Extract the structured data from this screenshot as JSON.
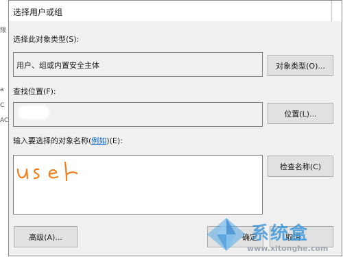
{
  "window_behind": {
    "fragments": [
      "限",
      "a",
      "C",
      "AC"
    ]
  },
  "dialog": {
    "title": "选择用户或组",
    "object_type": {
      "label": "选择此对象类型(S):",
      "value": "用户、组或内置安全主体",
      "button": "对象类型(O)..."
    },
    "location": {
      "label": "查找位置(F):",
      "value": "",
      "button": "位置(L)..."
    },
    "object_names": {
      "label_prefix": "输入要选择的对象名称(",
      "label_link": "例如",
      "label_suffix": ")(E):",
      "handwritten_value": "user",
      "button": "检查名称(C)"
    },
    "advanced_button": "高级(A)...",
    "ok_button": "确定",
    "cancel_button": "取消"
  },
  "watermark": {
    "brand": "系统盒",
    "url": "www.xitonghe.com"
  },
  "colors": {
    "dialog_bg": "#f0f0f0",
    "button_bg": "#e1e1e1",
    "link": "#0066cc",
    "handwriting": "#f07e1a",
    "watermark_blue": "#3a96dc"
  }
}
